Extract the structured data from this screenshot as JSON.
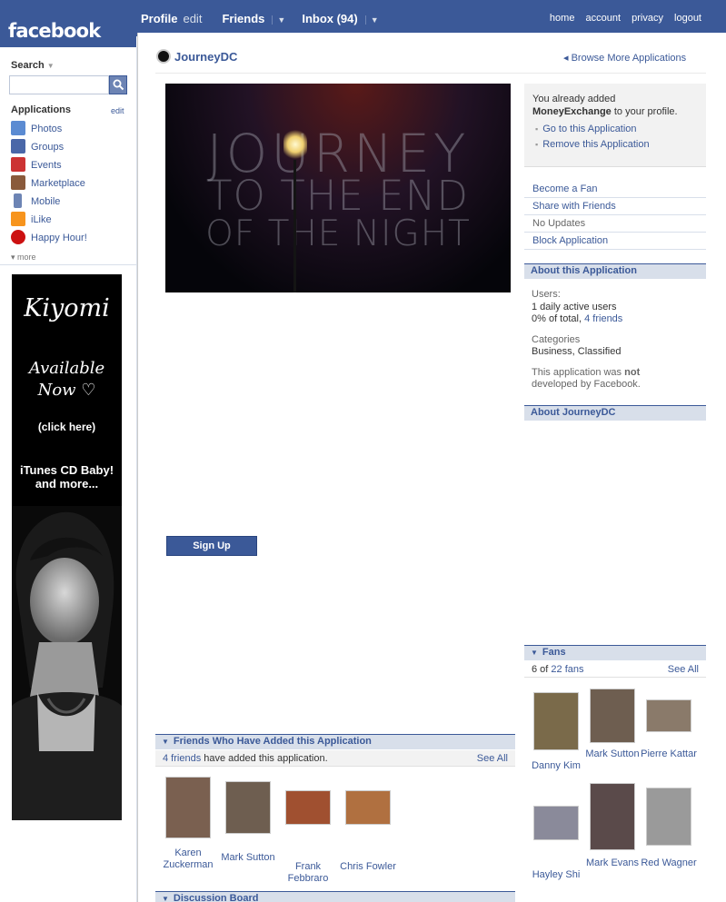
{
  "topbar": {
    "logo": "facebook",
    "nav": {
      "profile": "Profile",
      "edit": "edit",
      "friends": "Friends",
      "inbox": "Inbox (94)"
    },
    "right": [
      "home",
      "account",
      "privacy",
      "logout"
    ]
  },
  "sidebar": {
    "search_label": "Search",
    "search_placeholder": "",
    "apps_heading": "Applications",
    "apps_edit": "edit",
    "apps": [
      {
        "label": "Photos",
        "icon": "photos-icon",
        "color": "#5b8bd2"
      },
      {
        "label": "Groups",
        "icon": "groups-icon",
        "color": "#4a67a8"
      },
      {
        "label": "Events",
        "icon": "events-icon",
        "color": "#c33"
      },
      {
        "label": "Marketplace",
        "icon": "marketplace-icon",
        "color": "#8a5a3b"
      },
      {
        "label": "Mobile",
        "icon": "mobile-icon",
        "color": "#6d84b4"
      },
      {
        "label": "iLike",
        "icon": "ilike-icon",
        "color": "#f7941d"
      },
      {
        "label": "Happy Hour!",
        "icon": "cherry-icon",
        "color": "#cc1111"
      }
    ],
    "more": "more"
  },
  "ad": {
    "name": "Kiyomi",
    "available": "Available Now ♡",
    "click": "(click here)",
    "itunes": "iTunes CD Baby! and more..."
  },
  "page": {
    "app_name": "JourneyDC",
    "browse": "Browse More Applications",
    "banner": {
      "line1": "JOURNEY",
      "line2": "TO THE END",
      "line3": "OF THE NIGHT"
    },
    "signup": "Sign Up"
  },
  "right": {
    "added_prefix": "You already added",
    "added_app": "MoneyExchange",
    "added_suffix": "to your profile.",
    "goto": "Go to this Application",
    "remove": "Remove this Application",
    "actions": [
      "Become a Fan",
      "Share with Friends",
      "No Updates",
      "Block Application"
    ],
    "about_head": "About this Application",
    "users_label": "Users:",
    "users_active": "1 daily active users",
    "users_pct": "0% of total,",
    "users_friends": "4 friends",
    "cat_label": "Categories",
    "cat_value": "Business, Classified",
    "dev_a": "This application was",
    "dev_not": "not",
    "dev_b": "developed by Facebook.",
    "about_dc_head": "About JourneyDC",
    "fans_head": "Fans",
    "fans_count_a": "6 of",
    "fans_count_link": "22 fans",
    "fans_seeall": "See All",
    "fans": [
      {
        "name": "Danny Kim",
        "color": "#7a6a4a"
      },
      {
        "name": "Mark Sutton",
        "color": "#6e5e50"
      },
      {
        "name": "Pierre Kattar",
        "color": "#8a7a6a"
      },
      {
        "name": "Hayley Shi",
        "color": "#8a8a9a"
      },
      {
        "name": "Mark Evans",
        "color": "#5a4a4a"
      },
      {
        "name": "Red Wagner",
        "color": "#9a9a9a"
      }
    ]
  },
  "friends_box": {
    "head": "Friends Who Have Added this Application",
    "count_link": "4 friends",
    "count_text": "have added this application.",
    "seeall": "See All",
    "friends": [
      {
        "name": "Karen Zuckerman",
        "color": "#7a6050"
      },
      {
        "name": "Mark Sutton",
        "color": "#6e5e50"
      },
      {
        "name": "Frank Febbraro",
        "color": "#a05030"
      },
      {
        "name": "Chris Fowler",
        "color": "#b07040"
      }
    ]
  },
  "discussion": {
    "head": "Discussion Board"
  }
}
